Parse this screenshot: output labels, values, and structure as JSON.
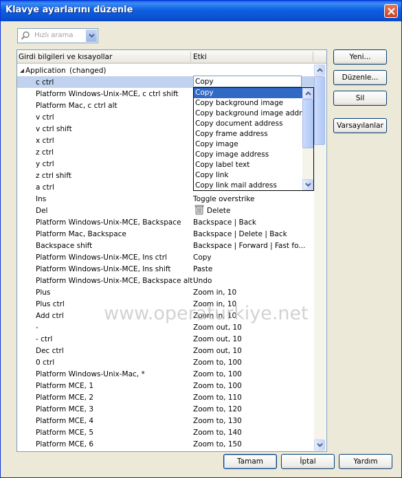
{
  "window": {
    "title": "Klavye ayarlarını düzenle"
  },
  "search": {
    "placeholder": "Hızlı arama"
  },
  "table": {
    "col_input": "Girdi bilgileri ve kısayollar",
    "col_action": "Etki",
    "group_label": "Application",
    "group_changed": "(changed)",
    "rows": [
      {
        "key": "c ctrl",
        "action": ""
      },
      {
        "key": "Platform Windows-Unix-MCE, c ctrl shift",
        "action": ""
      },
      {
        "key": "Platform Mac, c ctrl alt",
        "action": ""
      },
      {
        "key": "v ctrl",
        "action": ""
      },
      {
        "key": "v ctrl shift",
        "action": ""
      },
      {
        "key": "x ctrl",
        "action": ""
      },
      {
        "key": "z ctrl",
        "action": ""
      },
      {
        "key": "y ctrl",
        "action": ""
      },
      {
        "key": "z ctrl shift",
        "action": ""
      },
      {
        "key": "a ctrl",
        "action": ""
      },
      {
        "key": "Ins",
        "action": "Toggle overstrike"
      },
      {
        "key": "Del",
        "action": "Delete"
      },
      {
        "key": "Platform Windows-Unix-MCE, Backspace",
        "action": "Backspace | Back"
      },
      {
        "key": "Platform Mac, Backspace",
        "action": "Backspace | Delete | Back"
      },
      {
        "key": "Backspace shift",
        "action": "Backspace | Forward | Fast fo..."
      },
      {
        "key": "Platform Windows-Unix-MCE, Ins ctrl",
        "action": "Copy"
      },
      {
        "key": "Platform Windows-Unix-MCE, Ins shift",
        "action": "Paste"
      },
      {
        "key": "Platform Windows-Unix-MCE, Backspace alt",
        "action": "Undo"
      },
      {
        "key": "Plus",
        "action": "Zoom in, 10"
      },
      {
        "key": "Plus ctrl",
        "action": "Zoom in, 10"
      },
      {
        "key": "Add ctrl",
        "action": "Zoom in, 10"
      },
      {
        "key": "-",
        "action": "Zoom out, 10"
      },
      {
        "key": "- ctrl",
        "action": "Zoom out, 10"
      },
      {
        "key": "Dec ctrl",
        "action": "Zoom out, 10"
      },
      {
        "key": "0 ctrl",
        "action": "Zoom to, 100"
      },
      {
        "key": "Platform Windows-Unix-Mac, *",
        "action": "Zoom to, 100"
      },
      {
        "key": "Platform MCE, 1",
        "action": "Zoom to, 100"
      },
      {
        "key": "Platform MCE, 2",
        "action": "Zoom to, 110"
      },
      {
        "key": "Platform MCE, 3",
        "action": "Zoom to, 120"
      },
      {
        "key": "Platform MCE, 4",
        "action": "Zoom to, 130"
      },
      {
        "key": "Platform MCE, 5",
        "action": "Zoom to, 140"
      },
      {
        "key": "Platform MCE, 6",
        "action": "Zoom to, 150"
      }
    ]
  },
  "editor": {
    "value": "Copy",
    "options": [
      "Copy",
      "Copy background image",
      "Copy background image address",
      "Copy document address",
      "Copy frame address",
      "Copy image",
      "Copy image address",
      "Copy label text",
      "Copy link",
      "Copy link mail address"
    ]
  },
  "side_buttons": {
    "new": "Yeni...",
    "edit": "Düzenle...",
    "delete": "Sil",
    "defaults": "Varsayılanlar"
  },
  "footer": {
    "ok": "Tamam",
    "cancel": "İptal",
    "help": "Yardım"
  },
  "watermark": "www.operaturkiye.net",
  "colors": {
    "titlebar": "#0b54d6",
    "selection": "#316ac5",
    "row_selected": "#c1d2ee",
    "dialog_bg": "#ece9d8"
  }
}
